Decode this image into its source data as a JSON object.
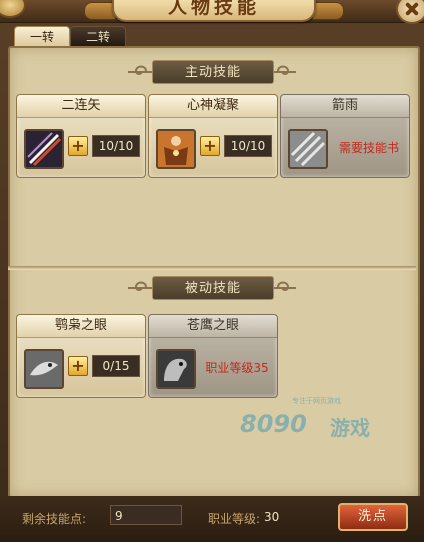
{
  "window": {
    "title": "人物技能"
  },
  "tabs": [
    {
      "label": "一转",
      "active": true
    },
    {
      "label": "二转",
      "active": false
    }
  ],
  "active_section": {
    "heading": "主动技能"
  },
  "passive_section": {
    "heading": "被动技能"
  },
  "active_skills": [
    {
      "name": "二连矢",
      "icon": "crossed-arrows-icon",
      "plus": "+",
      "level": "10/10"
    },
    {
      "name": "心神凝聚",
      "icon": "meditation-figure-icon",
      "plus": "+",
      "level": "10/10"
    },
    {
      "name": "箭雨",
      "icon": "arrow-rain-icon",
      "requirement": "需要技能书",
      "locked": true
    }
  ],
  "passive_skills": [
    {
      "name": "鹗枭之眼",
      "icon": "owl-eye-icon",
      "plus": "+",
      "level": "0/15"
    },
    {
      "name": "苍鹰之眼",
      "icon": "hawk-eye-icon",
      "requirement": "职业等级35",
      "locked": true
    }
  ],
  "footer": {
    "remaining_label": "剩余技能点:",
    "remaining_value": "9",
    "job_level_label": "职业等级:",
    "job_level_value": "30",
    "reset_button": "洗点"
  },
  "colors": {
    "requirement_text": "#c2281e",
    "reset_button": "#c0421e",
    "panel": "#d9cba3"
  }
}
